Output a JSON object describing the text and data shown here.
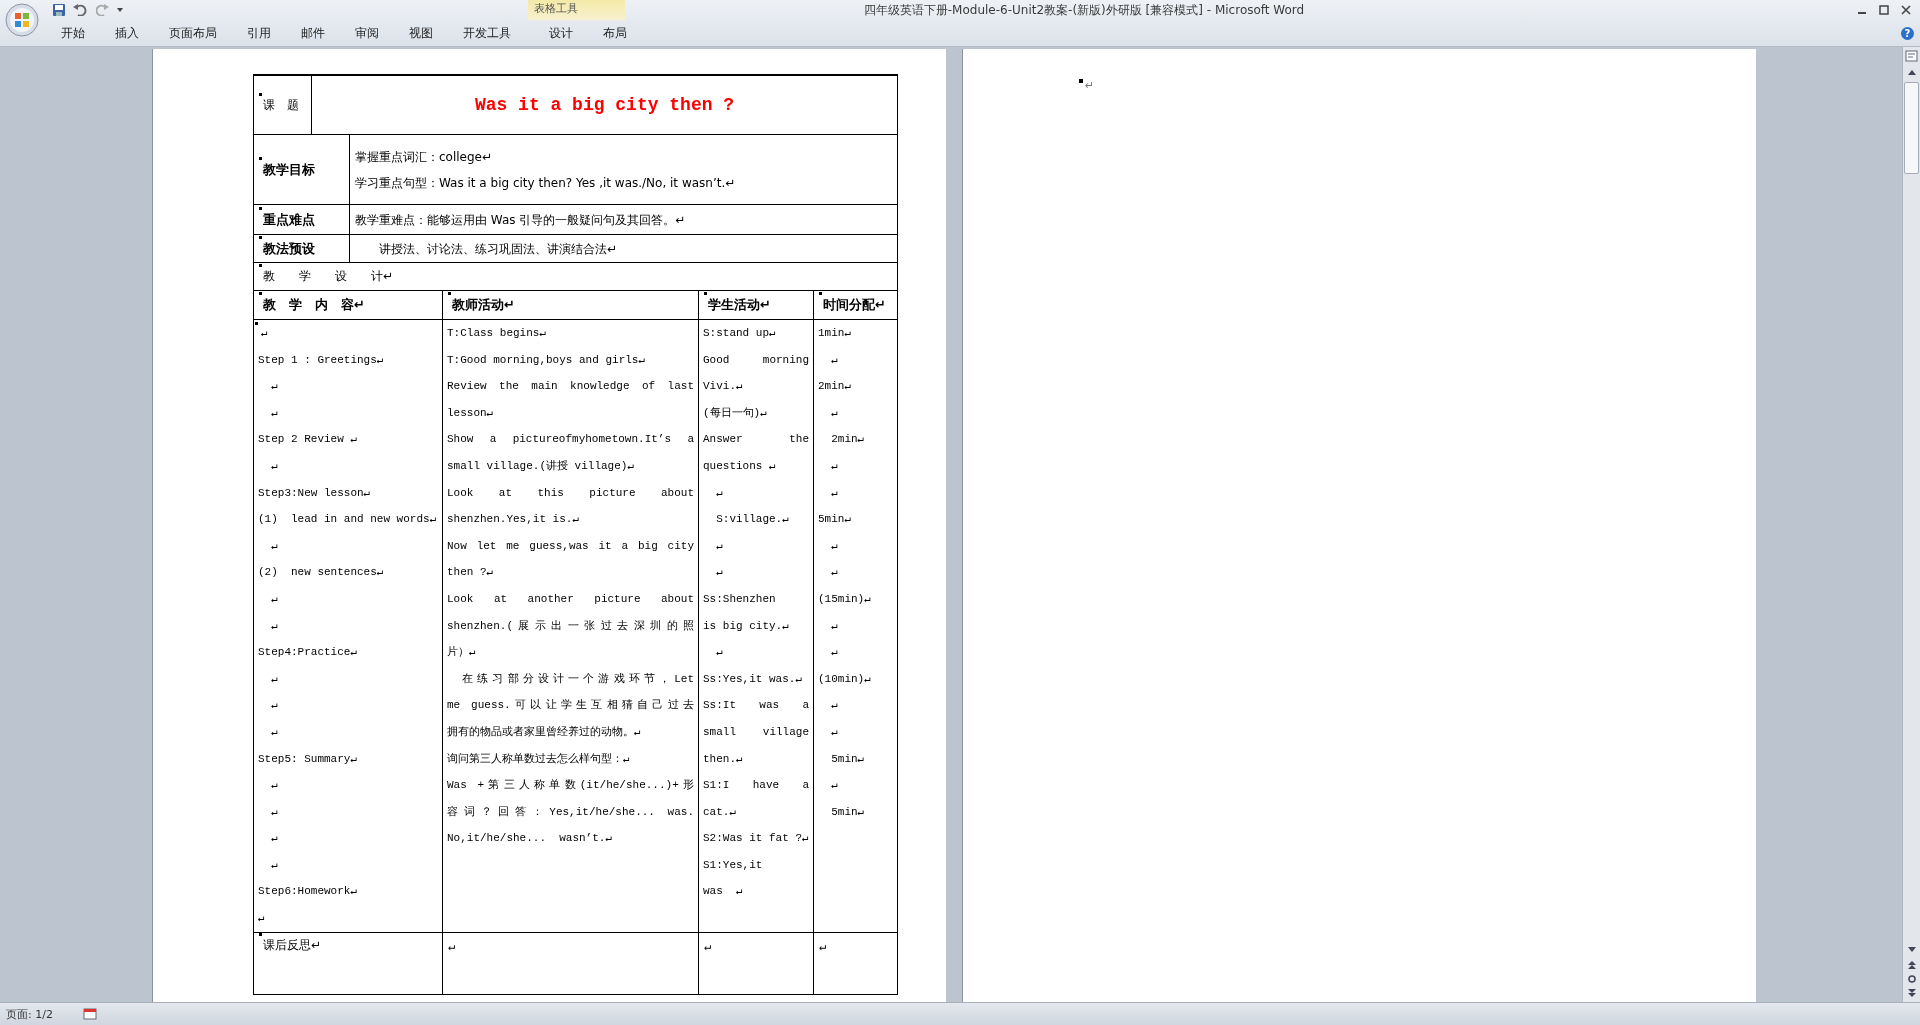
{
  "window": {
    "title": "四年级英语下册-Module-6-Unit2教案-(新版)外研版 [兼容模式] - Microsoft Word"
  },
  "ribbon": {
    "tabs": [
      {
        "label": "开始",
        "selected": false
      },
      {
        "label": "插入",
        "selected": false
      },
      {
        "label": "页面布局",
        "selected": false
      },
      {
        "label": "引用",
        "selected": false
      },
      {
        "label": "邮件",
        "selected": false
      },
      {
        "label": "审阅",
        "selected": false
      },
      {
        "label": "视图",
        "selected": false
      },
      {
        "label": "开发工具",
        "selected": false
      }
    ],
    "context_group": {
      "label": "表格工具",
      "tabs": [
        {
          "label": "设计",
          "selected": false
        },
        {
          "label": "布局",
          "selected": false
        }
      ]
    },
    "help": "?"
  },
  "document": {
    "title_row": {
      "label": "课　题",
      "title": "Was it a big city then ?"
    },
    "info_rows": [
      {
        "label": "教学目标",
        "lines": [
          "掌握重点词汇：college↵",
          "学习重点句型：Was it a big city then? Yes ,it was./No, it wasn’t.↵"
        ]
      },
      {
        "label": "重点难点",
        "lines": [
          "教学重难点：能够运用由 Was 引导的一般疑问句及其回答。↵"
        ]
      },
      {
        "label": "教法预设",
        "lines": [
          "　　讲授法、讨论法、练习巩固法、讲演结合法↵"
        ]
      }
    ],
    "design_heading": "教　　学　　设　　计↵",
    "columns": [
      {
        "label": "教　学　内　容↵"
      },
      {
        "label": "教师活动↵"
      },
      {
        "label": "学生活动↵"
      },
      {
        "label": "时间分配↵"
      }
    ],
    "body": [
      [
        [
          "↵"
        ],
        [
          "Step 1 : Greetings↵"
        ],
        [
          "  ↵"
        ],
        [
          "  ↵"
        ],
        [
          "Step 2 Review ↵"
        ],
        [
          "  ↵"
        ],
        [
          "Step3:New lesson↵"
        ],
        [
          "(1)  lead in and new words↵"
        ],
        [
          "  ↵"
        ],
        [
          "(2)  new sentences↵"
        ],
        [
          "  ↵"
        ],
        [
          "  ↵"
        ],
        [
          "Step4:Practice↵"
        ],
        [
          "  ↵"
        ],
        [
          "  ↵"
        ],
        [
          "  ↵"
        ],
        [
          "Step5: Summary↵"
        ],
        [
          "  ↵"
        ],
        [
          "  ↵"
        ],
        [
          "  ↵"
        ],
        [
          "  ↵"
        ],
        [
          "Step6:Homework↵"
        ],
        [
          "↵"
        ]
      ],
      [
        [
          "T:Class begins↵"
        ],
        [
          "T:Good morning,boys and girls↵"
        ],
        [
          "Review the main knowledge of  last",
          "lesson↵"
        ],
        [
          "Show a pictureofmyhometown.It’s a",
          "small village.(讲授 village)↵"
        ],
        [
          "Look at this picture about",
          "shenzhen.Yes,it is.↵"
        ],
        [
          "Now let me guess,was it a big city",
          "then ?↵"
        ],
        [
          "Look at another picture about",
          "shenzhen.(展示出一张过去深圳的照",
          "片）↵"
        ],
        [
          "　在练习部分设计一个游戏环节，Let",
          "me guess.可以让学生互相猜自己过去",
          "拥有的物品或者家里曾经养过的动物。↵"
        ],
        [
          "询问第三人称单数过去怎么样句型：↵"
        ],
        [
          "Was +第三人称单数(it/he/she...)+形",
          "容词？回答：Yes,it/he/she... was.",
          "No,it/he/she...  wasn’t.↵"
        ]
      ],
      [
        [
          "S:stand up↵"
        ],
        [
          "Good morning",
          "Vivi.↵"
        ],
        [
          "(每日一句)↵"
        ],
        [
          "Answer the",
          "questions ↵"
        ],
        [
          "  ↵"
        ],
        [
          "  S:village.↵"
        ],
        [
          "  ↵"
        ],
        [
          "  ↵"
        ],
        [
          "  Ss:Shenzhen",
          "is big city.↵"
        ],
        [
          "  ↵"
        ],
        [
          "Ss:Yes,it was.↵"
        ],
        [
          "Ss:It was a",
          "small village",
          "then.↵"
        ],
        [
          "S1:I have a",
          "cat.↵"
        ],
        [
          "S2:Was it fat ?↵"
        ],
        [
          "S1:Yes,it"
        ],
        [
          "was  ↵"
        ]
      ],
      [
        [
          "1min↵"
        ],
        [
          "  ↵"
        ],
        [
          "2min↵"
        ],
        [
          "  ↵"
        ],
        [
          "  2min↵"
        ],
        [
          "  ↵"
        ],
        [
          "  ↵"
        ],
        [
          "5min↵"
        ],
        [
          "  ↵"
        ],
        [
          "  ↵"
        ],
        [
          "(15min)↵"
        ],
        [
          "  ↵"
        ],
        [
          "  ↵"
        ],
        [
          "(10min)↵"
        ],
        [
          "  ↵"
        ],
        [
          "  ↵"
        ],
        [
          "  5min↵"
        ],
        [
          "  ↵"
        ],
        [
          "  5min↵"
        ]
      ]
    ],
    "reflection": {
      "label": "课后反思↵",
      "cells": [
        "↵",
        "↵",
        "↵"
      ]
    }
  },
  "second_page": {
    "mark": "↵"
  },
  "status_bar": {
    "page": "页面: 1/2"
  }
}
